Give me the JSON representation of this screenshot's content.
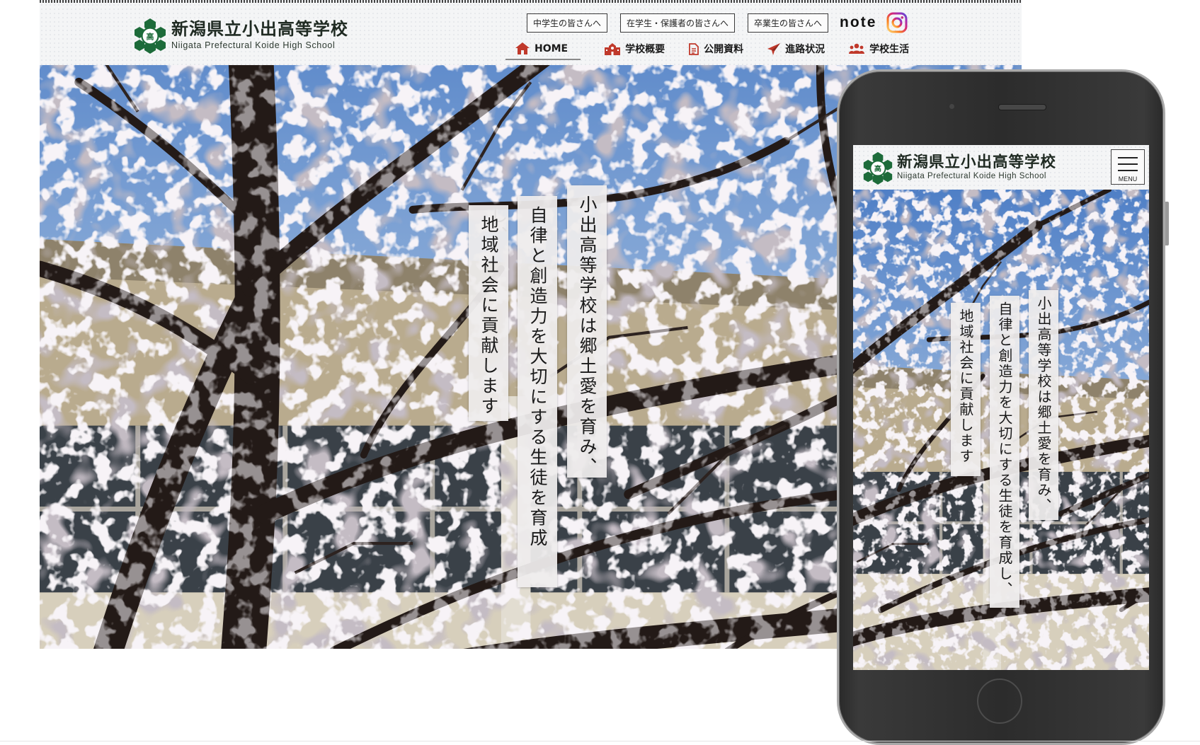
{
  "school": {
    "name_jp": "新潟県立小出高等学校",
    "name_en": "Niigata Prefectural Koide High School",
    "emblem_char": "高"
  },
  "top_links": [
    {
      "label": "中学生の皆さんへ"
    },
    {
      "label": "在学生・保護者の皆さんへ"
    },
    {
      "label": "卒業生の皆さんへ"
    }
  ],
  "social": {
    "note_label": "note",
    "instagram_icon": "instagram-icon"
  },
  "nav": [
    {
      "label": "HOME",
      "icon": "home-icon"
    },
    {
      "label": "学校概要",
      "icon": "school-icon"
    },
    {
      "label": "公開資料",
      "icon": "document-icon"
    },
    {
      "label": "進路状況",
      "icon": "paper-plane-icon"
    },
    {
      "label": "学校生活",
      "icon": "people-icon"
    }
  ],
  "hero": {
    "lines": [
      "小出高等学校は郷土愛を育み、",
      "自律と創造力を大切にする生徒を育成し、",
      "地域社会に貢献します"
    ]
  },
  "mobile": {
    "menu_label": "MENU"
  },
  "colors": {
    "brand_green": "#1d6b3a",
    "home_red": "#c0392b",
    "instagram_gradient": [
      "#feda75",
      "#fa7e1e",
      "#d62976",
      "#962fbf",
      "#4f5bd5"
    ]
  }
}
